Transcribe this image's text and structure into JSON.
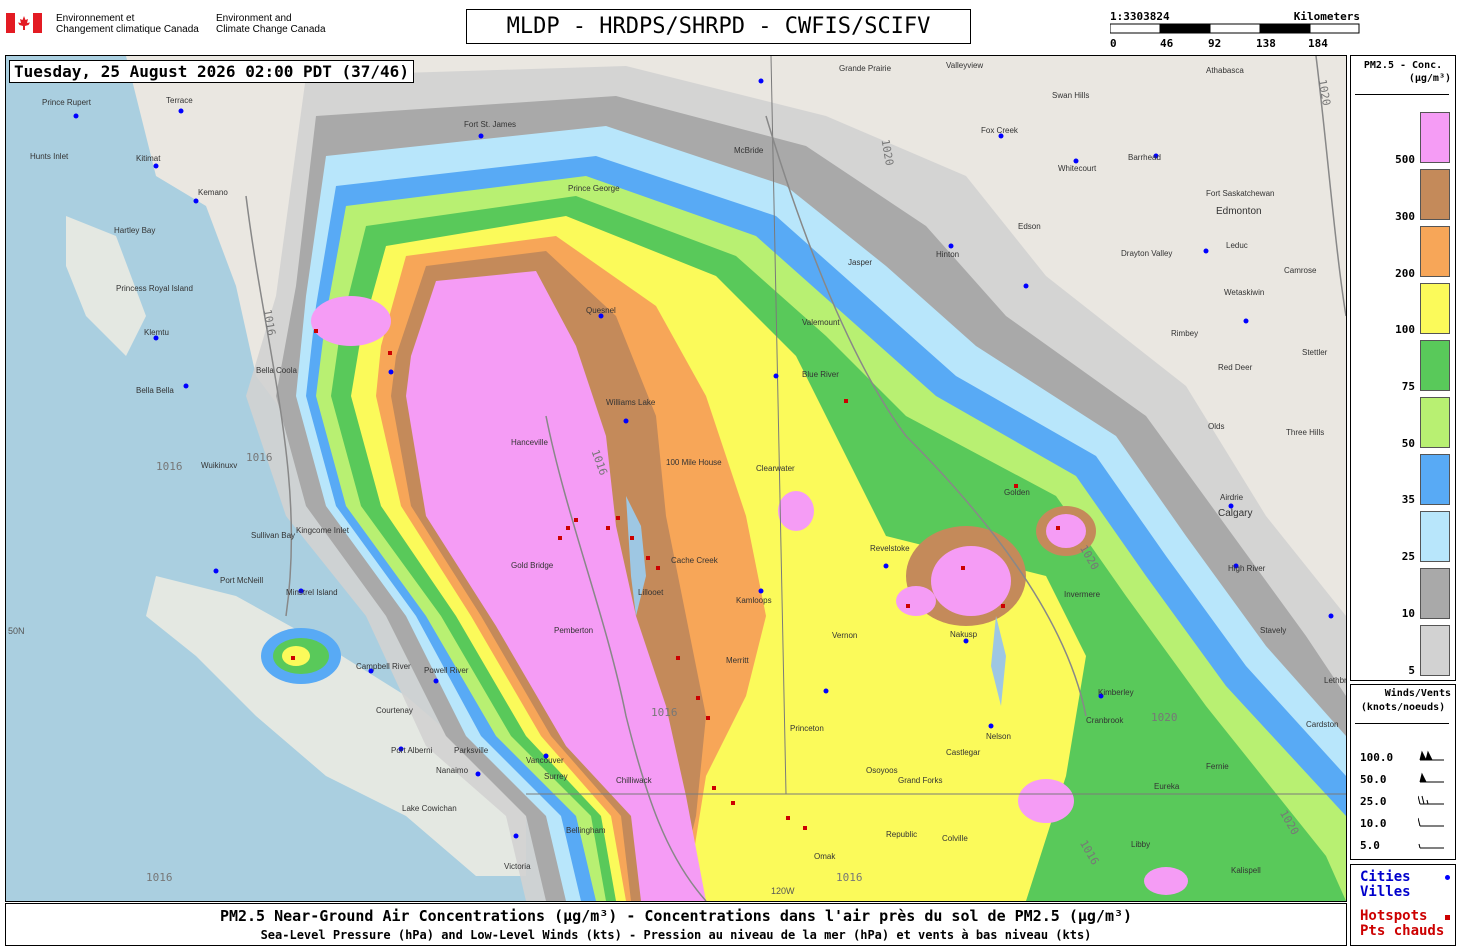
{
  "header": {
    "agency_fr_line1": "Environnement et",
    "agency_fr_line2": "Changement climatique Canada",
    "agency_en_line1": "Environment and",
    "agency_en_line2": "Climate Change Canada",
    "product_title": "MLDP - HRDPS/SHRPD - CWFIS/SCIFV"
  },
  "scale": {
    "ratio": "1:3303824",
    "unit": "Kilometers",
    "ticks": [
      "0",
      "46",
      "92",
      "138",
      "184"
    ]
  },
  "map": {
    "timestamp": "Tuesday, 25 August 2026 02:00 PDT (37/46)",
    "city_labels": [
      "Prince Rupert",
      "Terrace",
      "Kitimat",
      "Kemano",
      "Hartley Bay",
      "Princess Royal Island",
      "Klemtu",
      "Bella Bella",
      "Bella Coola",
      "Wuikinuxv",
      "Sullivan Bay",
      "Kingcome Inlet",
      "Port McNeill",
      "Minstrel Island",
      "Campbell River",
      "Powell River",
      "Courtenay",
      "Port Alberni",
      "Parksville",
      "Nanaimo",
      "Lake Cowichan",
      "Victoria",
      "Vancouver",
      "Surrey",
      "Chilliwack",
      "Bellingham",
      "Hunts Inlet",
      "Fort St. James",
      "Prince George",
      "Quesnel",
      "Williams Lake",
      "Hanceville",
      "100 Mile House",
      "Clearwater",
      "Cache Creek",
      "Kamloops",
      "Lillooet",
      "Gold Bridge",
      "Pemberton",
      "Merritt",
      "Princeton",
      "Osoyoos",
      "Vernon",
      "Revelstoke",
      "Nakusp",
      "Nelson",
      "Castlegar",
      "Grand Forks",
      "Republic",
      "Colville",
      "Omak",
      "Cranbrook",
      "Kimberley",
      "Invermere",
      "Libby",
      "Kalispell",
      "Eureka",
      "Fernie",
      "Valleyview",
      "Swan Hills",
      "Athabasca",
      "Fox Creek",
      "Whitecourt",
      "Barrhead",
      "Fort Saskatchewan",
      "Edmonton",
      "Edson",
      "Leduc",
      "Hinton",
      "Drayton Valley",
      "Camrose",
      "Wetaskiwin",
      "Rimbey",
      "Red Deer",
      "Stettler",
      "Olds",
      "Three Hills",
      "Airdrie",
      "Calgary",
      "High River",
      "Stavely",
      "Lethbridge",
      "Grande Prairie",
      "Valemount",
      "McBride",
      "Jasper",
      "Golden",
      "Cardston",
      "Blue River"
    ],
    "isobar_labels": [
      "1016",
      "1020"
    ],
    "graticule_labels": [
      "50N",
      "120W"
    ]
  },
  "legend_pm": {
    "title_line1": "PM2.5 - Conc.",
    "title_line2": "(µg/m³)",
    "levels": [
      {
        "value": "500",
        "color": "#f59cf5"
      },
      {
        "value": "300",
        "color": "#c48a5a"
      },
      {
        "value": "200",
        "color": "#f7a658"
      },
      {
        "value": "100",
        "color": "#fbfa5a"
      },
      {
        "value": "75",
        "color": "#59c95a"
      },
      {
        "value": "50",
        "color": "#b8f072"
      },
      {
        "value": "35",
        "color": "#58aaf5"
      },
      {
        "value": "25",
        "color": "#b8e6fb"
      },
      {
        "value": "10",
        "color": "#a9a9a9"
      },
      {
        "value": "5",
        "color": "#d2d2d2"
      }
    ]
  },
  "legend_wind": {
    "title_line1": "Winds/Vents",
    "title_line2": "(knots/noeuds)",
    "rows": [
      "100.0",
      "50.0",
      "25.0",
      "10.0",
      "5.0"
    ]
  },
  "legend_points": {
    "cities_en": "Cities",
    "cities_fr": "Villes",
    "hotspots_en": "Hotspots",
    "hotspots_fr": "Pts chauds",
    "city_color": "#0000ff",
    "hotspot_color": "#cc0000"
  },
  "footer": {
    "line1": "PM2.5 Near-Ground Air Concentrations (µg/m³) - Concentrations dans l'air près du sol de PM2.5 (µg/m³)",
    "line2": "Sea-Level Pressure (hPa) and Low-Level Winds (kts) - Pression au niveau de la mer (hPa) et vents à bas niveau (kts)"
  }
}
